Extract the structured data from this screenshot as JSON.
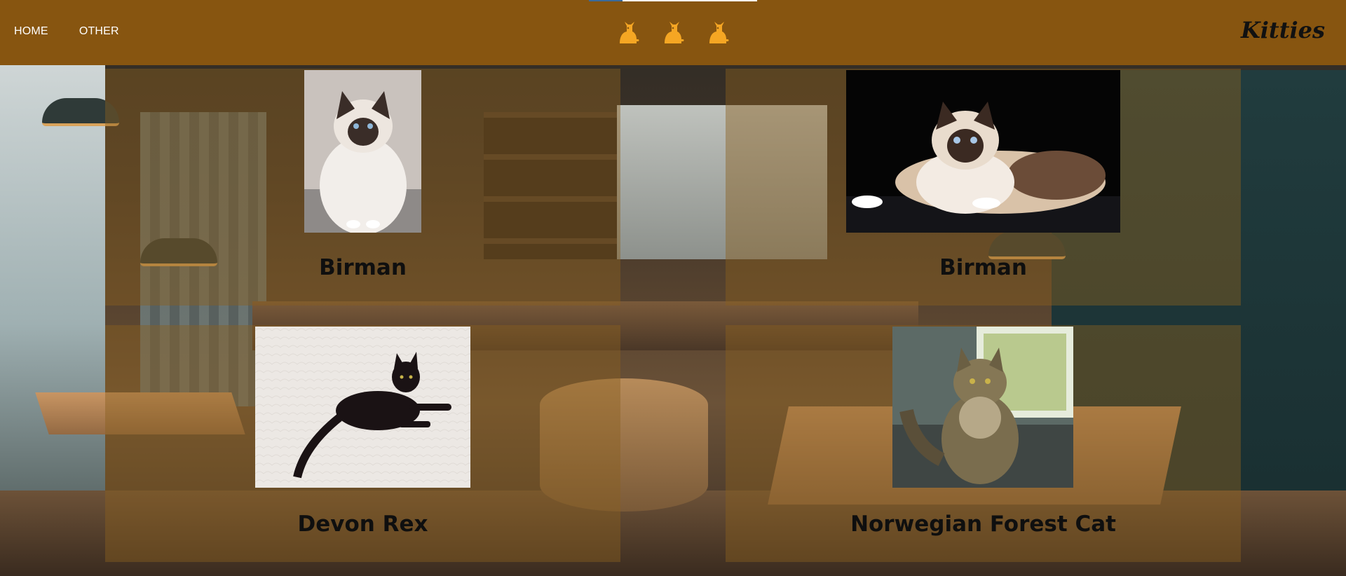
{
  "nav": {
    "home": "HOME",
    "other": "OTHER"
  },
  "header": {
    "brand": "Kitties",
    "icons": [
      "cat-icon",
      "cat-icon",
      "cat-icon"
    ],
    "icon_color": "#f5a623",
    "background": "#875510"
  },
  "cards": [
    {
      "title": "Birman",
      "image": "birman-photo"
    },
    {
      "title": "Birman",
      "image": "birman-photo"
    },
    {
      "title": "Devon Rex",
      "image": "devon-rex-photo"
    },
    {
      "title": "Norwegian Forest Cat",
      "image": "norwegian-forest-cat-photo"
    }
  ]
}
